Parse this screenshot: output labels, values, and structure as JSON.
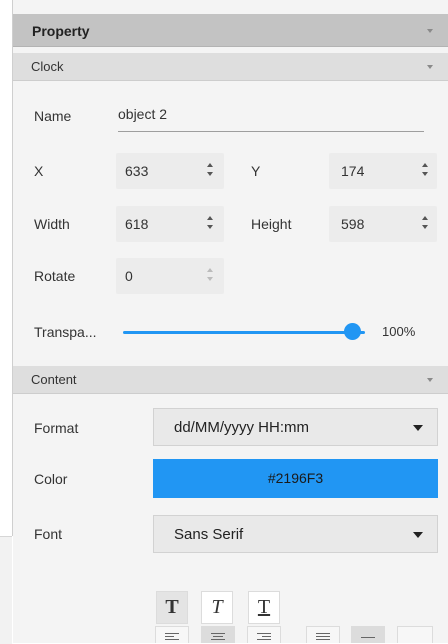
{
  "panel": {
    "title": "Property"
  },
  "sections": {
    "clock": {
      "title": "Clock"
    },
    "content": {
      "title": "Content"
    }
  },
  "clock": {
    "name": {
      "label": "Name",
      "value": "object 2"
    },
    "x": {
      "label": "X",
      "value": "633"
    },
    "y": {
      "label": "Y",
      "value": "174"
    },
    "width": {
      "label": "Width",
      "value": "618"
    },
    "height": {
      "label": "Height",
      "value": "598"
    },
    "rotate": {
      "label": "Rotate",
      "value": "0"
    },
    "transparency": {
      "label": "Transpa...",
      "value_text": "100%",
      "value_fraction": 1.0
    }
  },
  "content": {
    "format": {
      "label": "Format",
      "value": "dd/MM/yyyy HH:mm"
    },
    "color": {
      "label": "Color",
      "value": "#2196F3"
    },
    "font": {
      "label": "Font",
      "value": "Sans Serif"
    },
    "text_styles": [
      {
        "name": "bold",
        "glyph": "T",
        "active": true
      },
      {
        "name": "italic",
        "glyph": "T",
        "active": false
      },
      {
        "name": "underline",
        "glyph": "T",
        "active": false
      }
    ],
    "alignments": [
      {
        "name": "align-left",
        "active": false
      },
      {
        "name": "align-center",
        "active": true
      },
      {
        "name": "align-right",
        "active": false
      },
      {
        "name": "align-justify",
        "active": false
      },
      {
        "name": "align-top",
        "active": true
      },
      {
        "name": "align-middle",
        "active": false
      }
    ]
  },
  "colors": {
    "accent": "#2196F3",
    "header_bg": "#C3C3C3",
    "section_bg": "#DEDEDE",
    "panel_bg": "#F4F4F4"
  },
  "icons": {
    "collapse": "chevron-down-icon",
    "spinner": "spinner-arrows-icon",
    "dropdown": "dropdown-arrow-icon"
  }
}
